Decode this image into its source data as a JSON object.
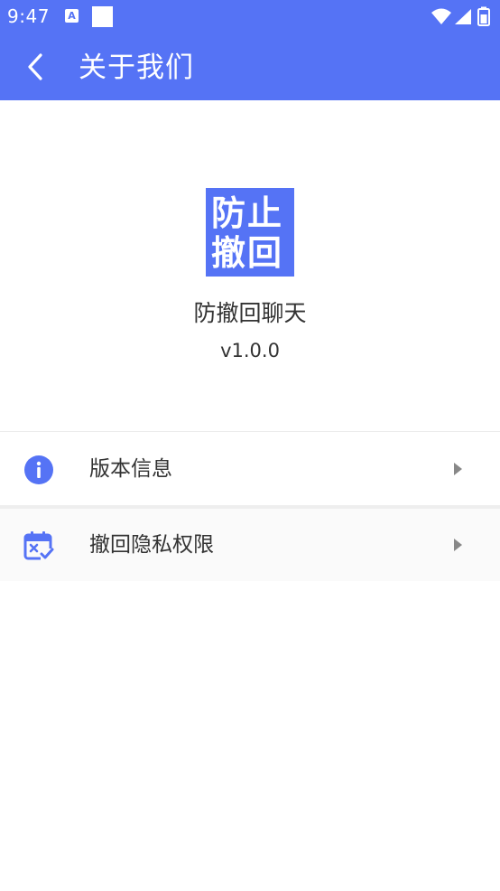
{
  "status_bar": {
    "time": "9:47",
    "notification_letter": "A"
  },
  "app_bar": {
    "title": "关于我们"
  },
  "header": {
    "logo_line_1": "防止",
    "logo_line_2": "撤回",
    "app_name": "防撤回聊天",
    "version": "v1.0.0"
  },
  "menu": {
    "items": [
      {
        "label": "版本信息",
        "icon": "info-icon"
      },
      {
        "label": "撤回隐私权限",
        "icon": "calendar-check-icon"
      }
    ]
  },
  "colors": {
    "primary": "#5573f5",
    "text": "#333333",
    "chevron": "#888888"
  }
}
